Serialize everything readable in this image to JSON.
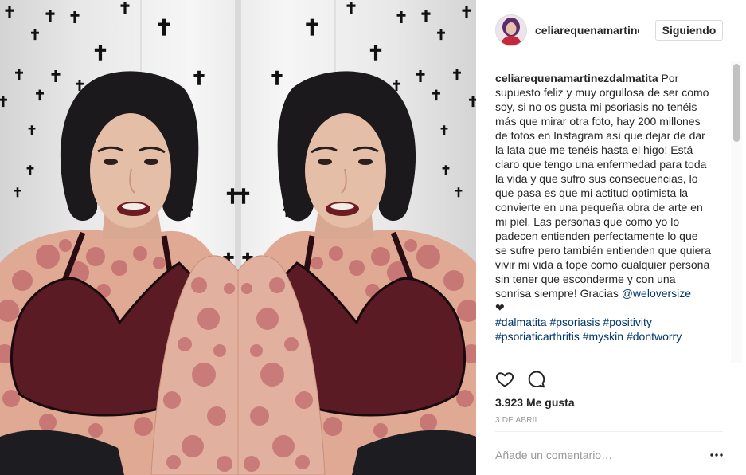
{
  "post": {
    "username": "celiarequenamartinezdalmatita",
    "follow_button_label": "Siguiendo",
    "caption": {
      "text": "Por supuesto feliz y muy orgullosa de ser como soy, si no os gusta mi psoriasis no tenéis más que mirar otra foto, hay 200 millones de fotos en Instagram así que dejar de dar la lata que me tenéis hasta el higo! Está claro que tengo una enfermedad para toda la vida y que sufro sus consecuencias, lo que pasa es que mi actitud optimista la convierte en una pequeña obra de arte en mi piel. Las personas que como yo lo padecen entienden perfectamente lo que se sufre pero también entienden que quiera vivir mi vida a tope como cualquier persona sin tener que esconderme y con una sonrisa siempre! Gracias",
      "mention": "@weloversize",
      "emoji": "❤",
      "hashtags": [
        "#dalmatita",
        "#psoriasis",
        "#positivity",
        "#psoriaticarthritis",
        "#myskin",
        "#dontworry"
      ]
    },
    "likes_count": "3.923",
    "likes_label": "Me gusta",
    "date": "3 DE ABRIL",
    "comment_placeholder": "Añade un comentario…"
  },
  "icons": {
    "like": "heart-outline-icon",
    "comment": "comment-bubble-icon",
    "more": "more-options-icon"
  },
  "colors": {
    "text": "#262626",
    "link": "#003569",
    "muted": "#999999",
    "button_border": "#dbdbdb",
    "divider": "#efefef",
    "scroll_thumb": "#c1c1c1"
  }
}
